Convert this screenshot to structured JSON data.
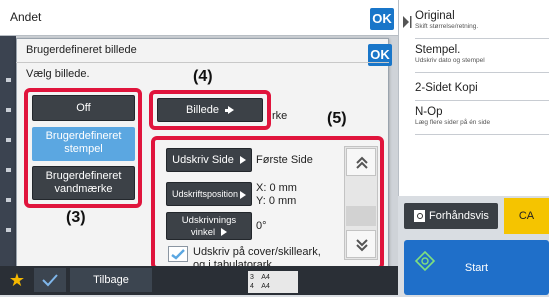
{
  "header": {
    "title": "Andet",
    "ok_label": "OK"
  },
  "dialog": {
    "title": "Brugerdefineret billede",
    "ok_label": "OK",
    "prompt": "Vælg billede.",
    "options": [
      {
        "label": "Off"
      },
      {
        "label_line1": "Brugerdefineret",
        "label_line2": "stempel"
      },
      {
        "label_line1": "Brugerdefineret",
        "label_line2": "vandmærke"
      }
    ],
    "image_button": "Billede",
    "image_suffix": "rke",
    "settings": [
      {
        "button": "Udskriv Side",
        "value_line1": "Første Side",
        "value_line2": ""
      },
      {
        "button": "Udskriftsposition",
        "value_line1": "X: 0 mm",
        "value_line2": "Y: 0 mm"
      },
      {
        "button_line1": "Udskrivnings",
        "button_line2": "vinkel",
        "value_line1": "0°",
        "value_line2": ""
      }
    ],
    "checkbox_label_line1": "Udskriv på cover/skilleark,",
    "checkbox_label_line2": "og i tabulatorark"
  },
  "callouts": {
    "c3": "(3)",
    "c4": "(4)",
    "c5": "(5)"
  },
  "right_menu": [
    {
      "main": "Original",
      "sub": "Skift størrelse/retning."
    },
    {
      "main": "Stempel.",
      "sub": "Udskriv dato og stempel"
    },
    {
      "main": "2-Sidet Kopi",
      "sub": ""
    },
    {
      "main": "N-Op",
      "sub": "Læg flere sider på én side"
    }
  ],
  "preview_button": "Forhåndsvis",
  "ca_button": "CA",
  "start_button": "Start",
  "bottom": {
    "back_label": "Tilbage",
    "page_row1": "3    A4",
    "page_row2": "4    A4"
  },
  "colors": {
    "accent_blue": "#1976c9",
    "callout_red": "#e0143c",
    "ca_yellow": "#f5c400",
    "start_blue": "#1f6fc9"
  }
}
